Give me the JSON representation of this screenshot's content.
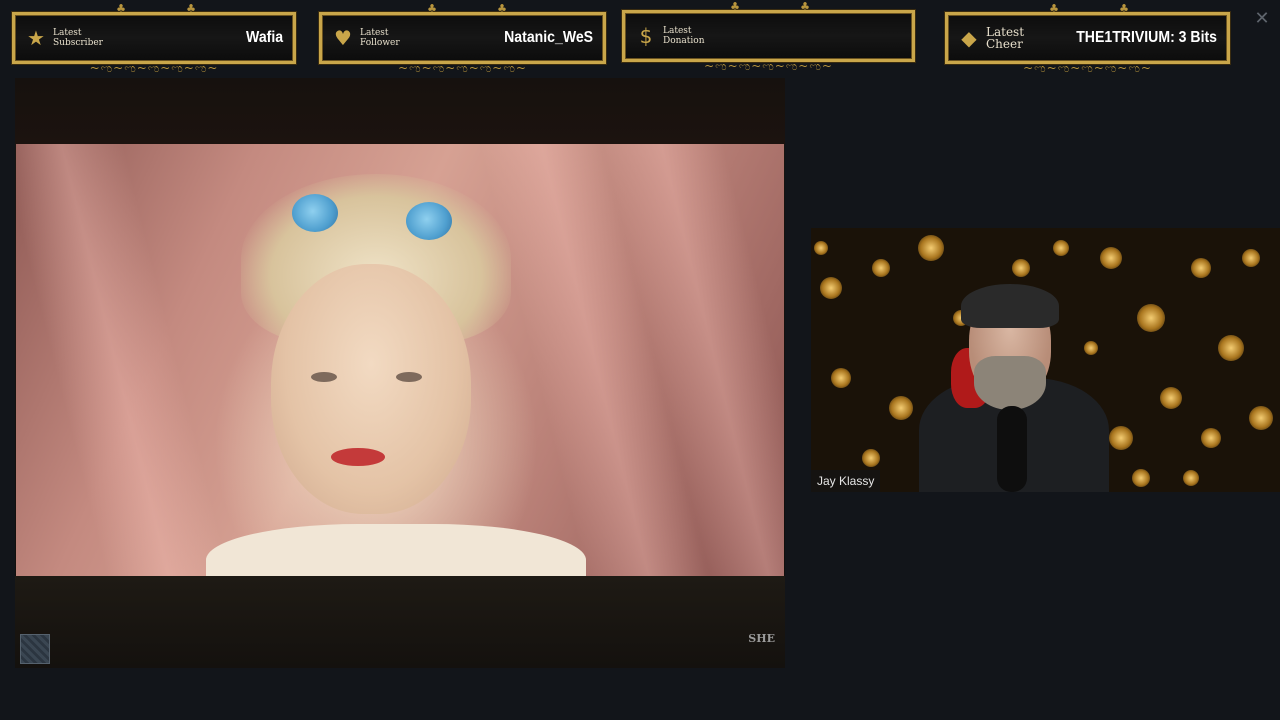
{
  "alerts": [
    {
      "icon": "star-icon",
      "caption": "Latest Subscriber",
      "name": "Wafia"
    },
    {
      "icon": "heart-icon",
      "caption": "Latest Follower",
      "name": "Natanic_WeS"
    },
    {
      "icon": "dollar-icon",
      "caption": "Latest Donation",
      "name": ""
    },
    {
      "icon": "diamond-icon",
      "caption": "Latest Cheer",
      "name": "THE1TRIVIUM: 3 Bits"
    }
  ],
  "video": {
    "logo": "SHE"
  },
  "webcam": {
    "name": "Jay Klassy"
  },
  "window": {
    "close_glyph": "✕"
  },
  "colors": {
    "gold": "#c9a64a",
    "background": "#12151a"
  }
}
